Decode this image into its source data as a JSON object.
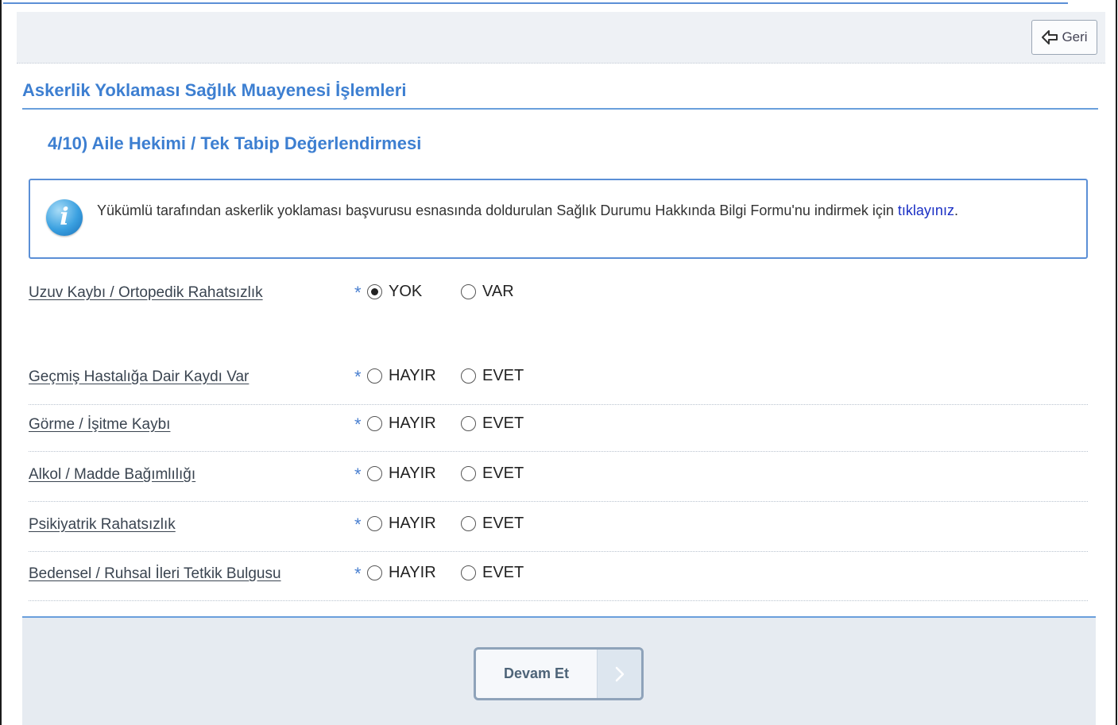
{
  "toolbar": {
    "back_label": "Geri"
  },
  "page_title": "Askerlik Yoklaması Sağlık Muayenesi İşlemleri",
  "step_title": "4/10) Aile Hekimi / Tek Tabip Değerlendirmesi",
  "info": {
    "text": "Yükümlü tarafından askerlik yoklaması başvurusu esnasında doldurulan Sağlık Durumu Hakkında Bilgi Formu'nu indirmek için ",
    "link": "tıklayınız",
    "suffix": "."
  },
  "required_mark": "*",
  "questions": [
    {
      "label": "Uzuv Kaybı / Ortopedik Rahatsızlık",
      "option1": "YOK",
      "option2": "VAR",
      "selected": "YOK"
    },
    {
      "label": "Geçmiş Hastalığa Dair Kaydı Var",
      "option1": "HAYIR",
      "option2": "EVET",
      "selected": ""
    },
    {
      "label": "Görme / İşitme Kaybı",
      "option1": "HAYIR",
      "option2": "EVET",
      "selected": ""
    },
    {
      "label": "Alkol / Madde Bağımlılığı",
      "option1": "HAYIR",
      "option2": "EVET",
      "selected": ""
    },
    {
      "label": "Psikiyatrik Rahatsızlık",
      "option1": "HAYIR",
      "option2": "EVET",
      "selected": ""
    },
    {
      "label": "Bedensel / Ruhsal İleri Tetkik Bulgusu",
      "option1": "HAYIR",
      "option2": "EVET",
      "selected": ""
    }
  ],
  "footer": {
    "continue_label": "Devam Et",
    "continue_icon": "chevron-right-icon",
    "back_icon": "arrow-left-icon"
  },
  "colors": {
    "accent": "#3d7fd1",
    "link": "#1a2fc4",
    "footer_bg": "#e6ebf1"
  }
}
